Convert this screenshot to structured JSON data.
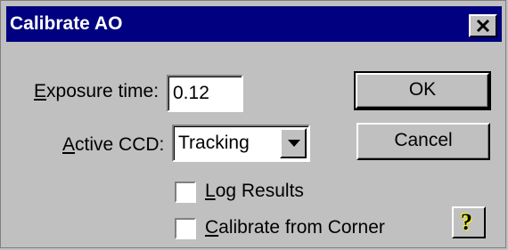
{
  "window": {
    "title": "Calibrate AO",
    "close_glyph": "×"
  },
  "fields": {
    "exposure": {
      "label_accel": "E",
      "label_rest": "xposure time:",
      "value": "0.12"
    },
    "active_ccd": {
      "label_accel": "A",
      "label_rest": "ctive CCD:",
      "selected": "Tracking"
    }
  },
  "checkboxes": [
    {
      "label_accel": "L",
      "label_rest": "og Results",
      "checked": false
    },
    {
      "label_accel": "C",
      "label_rest": "alibrate from Corner",
      "checked": false
    }
  ],
  "buttons": {
    "ok": "OK",
    "cancel": "Cancel",
    "help_glyph": "?"
  },
  "colors": {
    "title_bar": "#000080",
    "face": "#c0c0c0",
    "help_accent": "#ffff00"
  },
  "icons": {
    "close": "close-icon",
    "dropdown": "chevron-down-icon",
    "help": "help-icon"
  }
}
